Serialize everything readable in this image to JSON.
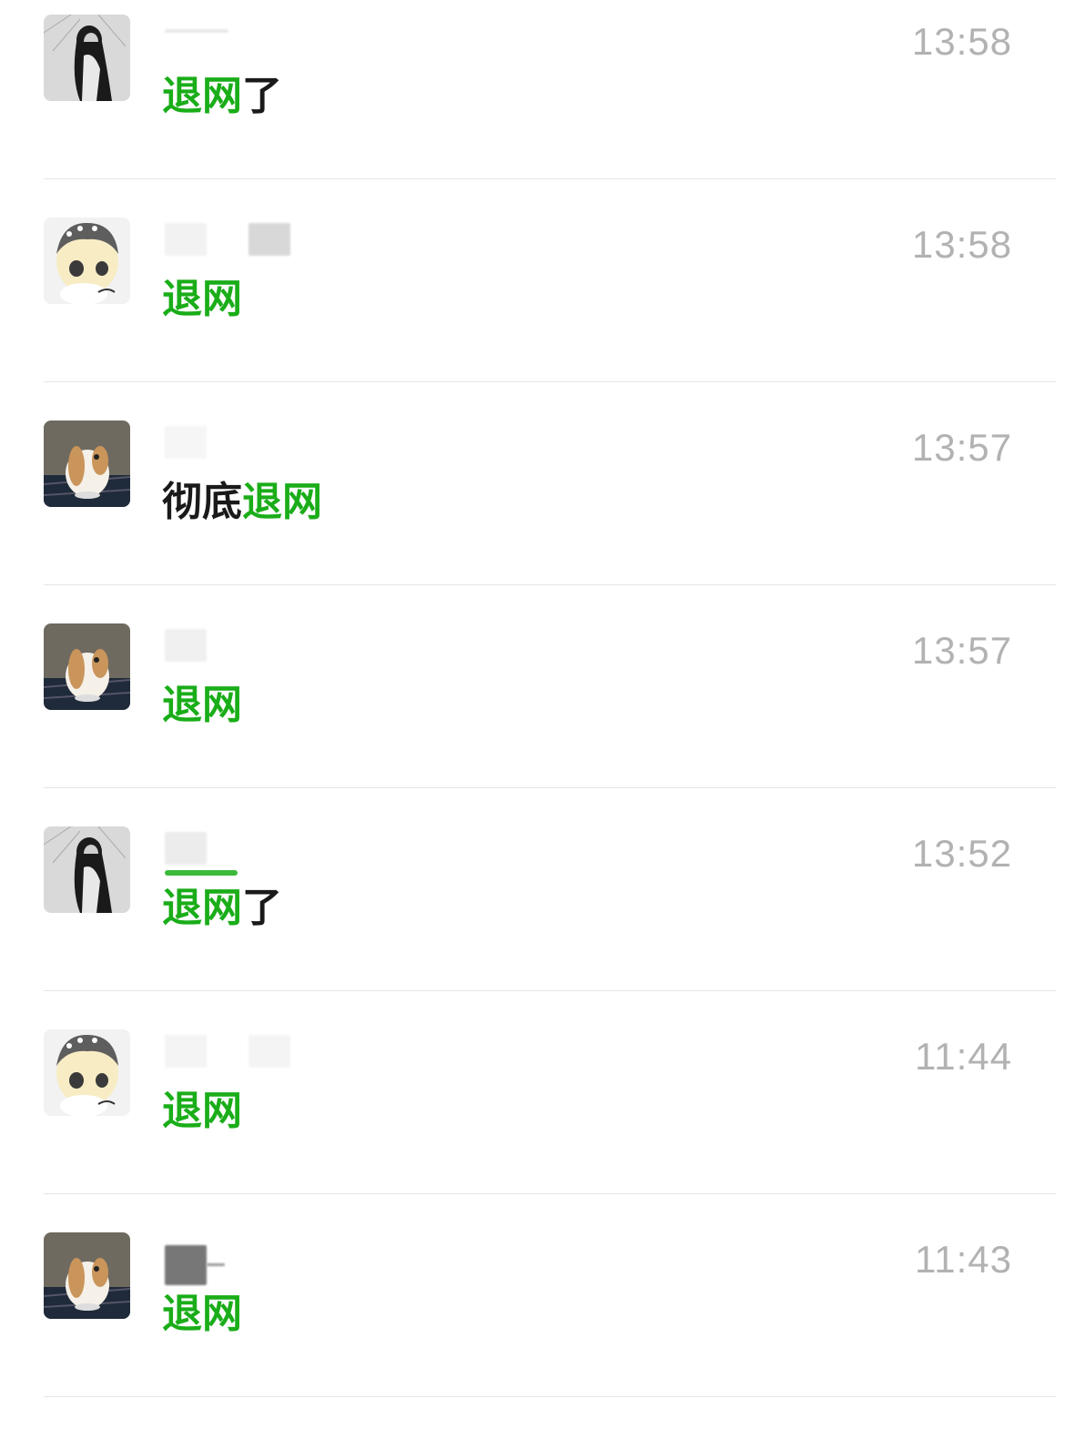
{
  "conversations": [
    {
      "avatar": "girl-photo-avatar",
      "time": "13:58",
      "message": [
        {
          "text": "退网",
          "style": "green"
        },
        {
          "text": "了",
          "style": "dark"
        }
      ]
    },
    {
      "avatar": "anime-girl-avatar",
      "time": "13:58",
      "message": [
        {
          "text": "退网",
          "style": "green"
        }
      ]
    },
    {
      "avatar": "bunny-avatar",
      "time": "13:57",
      "message": [
        {
          "text": "彻底",
          "style": "dark"
        },
        {
          "text": "退网",
          "style": "green"
        }
      ]
    },
    {
      "avatar": "bunny-avatar",
      "time": "13:57",
      "message": [
        {
          "text": "退网",
          "style": "green"
        }
      ]
    },
    {
      "avatar": "girl-photo-avatar",
      "time": "13:52",
      "message": [
        {
          "text": "退网",
          "style": "green"
        },
        {
          "text": "了",
          "style": "dark"
        }
      ]
    },
    {
      "avatar": "anime-girl-avatar",
      "time": "11:44",
      "message": [
        {
          "text": "退网",
          "style": "green"
        }
      ]
    },
    {
      "avatar": "bunny-avatar",
      "time": "11:43",
      "message": [
        {
          "text": "退网",
          "style": "green"
        }
      ]
    }
  ],
  "colors": {
    "highlight": "#1aad19",
    "time": "#b2b2b2",
    "divider": "#e5e5e5"
  }
}
